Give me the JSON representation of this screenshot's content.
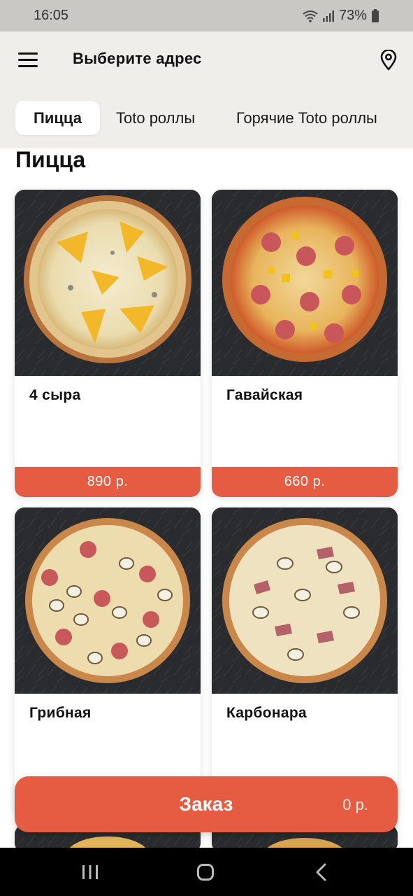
{
  "status_bar": {
    "time": "16:05",
    "battery": "73%"
  },
  "header": {
    "title": "Выберите адрес"
  },
  "tabs": [
    {
      "label": "Пицца",
      "active": true
    },
    {
      "label": "Toto роллы",
      "active": false
    },
    {
      "label": "Горячие Toto роллы",
      "active": false
    }
  ],
  "section": {
    "title": "Пицца"
  },
  "products": [
    {
      "name": "4 сыра",
      "price": "890 р."
    },
    {
      "name": "Гавайская",
      "price": "660 р."
    },
    {
      "name": "Грибная",
      "price": ""
    },
    {
      "name": "Карбонара",
      "price": ""
    }
  ],
  "order": {
    "label": "Заказ",
    "total": "0 р."
  },
  "colors": {
    "accent": "#e65c42",
    "header_bg": "#efeeea",
    "status_bg": "#c9c8c4"
  },
  "icons": [
    "menu-icon",
    "location-pin-icon",
    "wifi-icon",
    "signal-icon",
    "battery-icon",
    "recent-apps-icon",
    "home-icon",
    "back-icon"
  ]
}
